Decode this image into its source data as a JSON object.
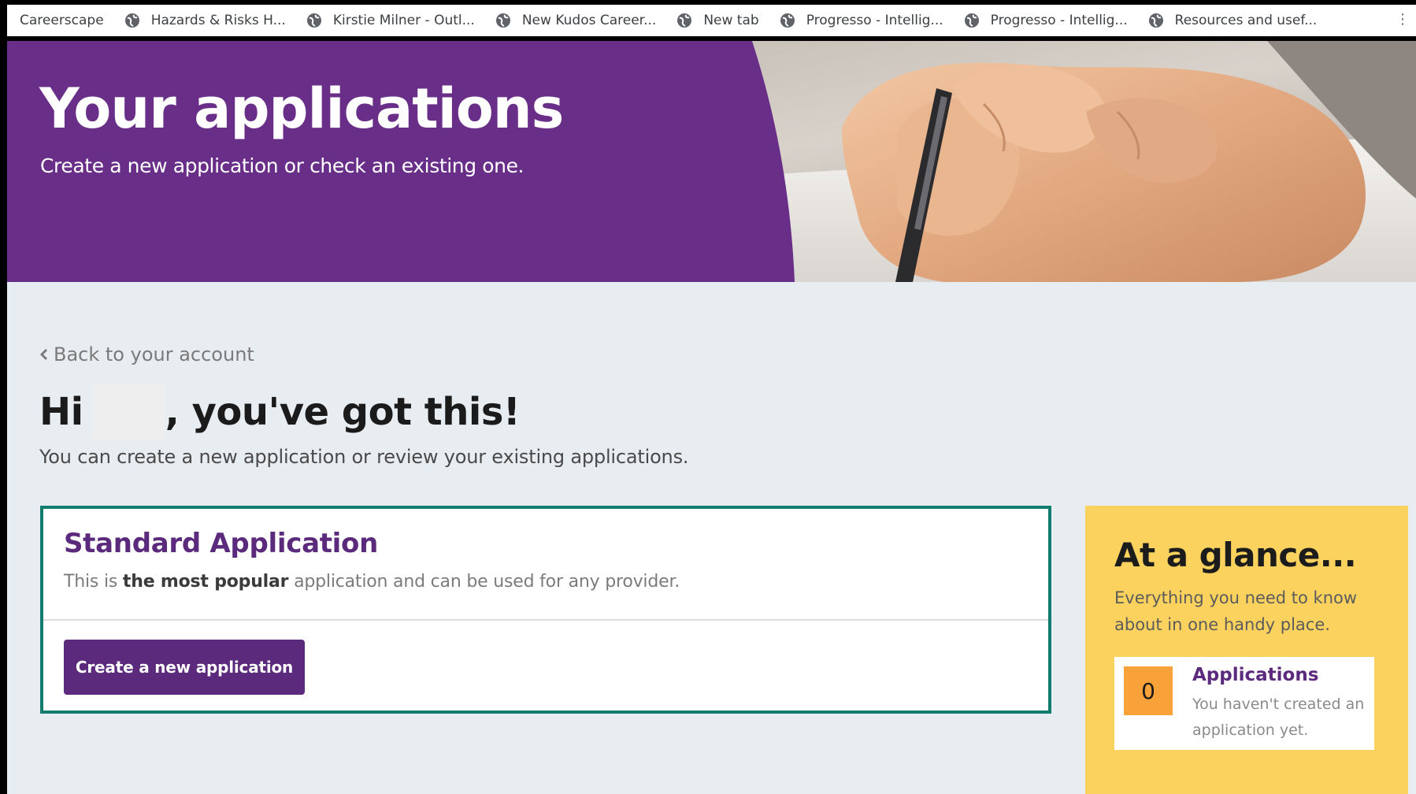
{
  "bookmarks": {
    "first": "Careerscape",
    "items": [
      "Hazards & Risks  H...",
      "Kirstie Milner - Outl...",
      "New Kudos Career...",
      "New tab",
      "Progresso - Intellig...",
      "Progresso - Intellig...",
      "Resources and usef..."
    ],
    "item_icon": "globe-icon",
    "overflow_icon": "more-icon",
    "overflow_glyph": "⋮"
  },
  "hero": {
    "title": "Your applications",
    "subtitle": "Create a new application or check an existing one.",
    "image": "hand-writing-with-pen-photo"
  },
  "main": {
    "back_link": "Back to your account",
    "greeting_prefix": "Hi",
    "greeting_suffix": ", you've got this!",
    "intro": "You can create a new application or review your existing applications."
  },
  "card": {
    "title": "Standard Application",
    "desc_before": "This is ",
    "desc_bold": "the most popular",
    "desc_after": " application and can be used for any provider.",
    "button": "Create a new application"
  },
  "glance": {
    "title": "At a glance...",
    "desc": "Everything you need to know about in one handy place.",
    "stat_count": "0",
    "stat_label": "Applications",
    "stat_text": "You haven't created an application yet."
  },
  "colors": {
    "brand_purple": "#682e88",
    "dark_purple": "#5b2a7c",
    "teal_border": "#127c6e",
    "glance_yellow": "#fcd25e",
    "badge_orange": "#f9a23a",
    "page_bg": "#e8edf1"
  }
}
